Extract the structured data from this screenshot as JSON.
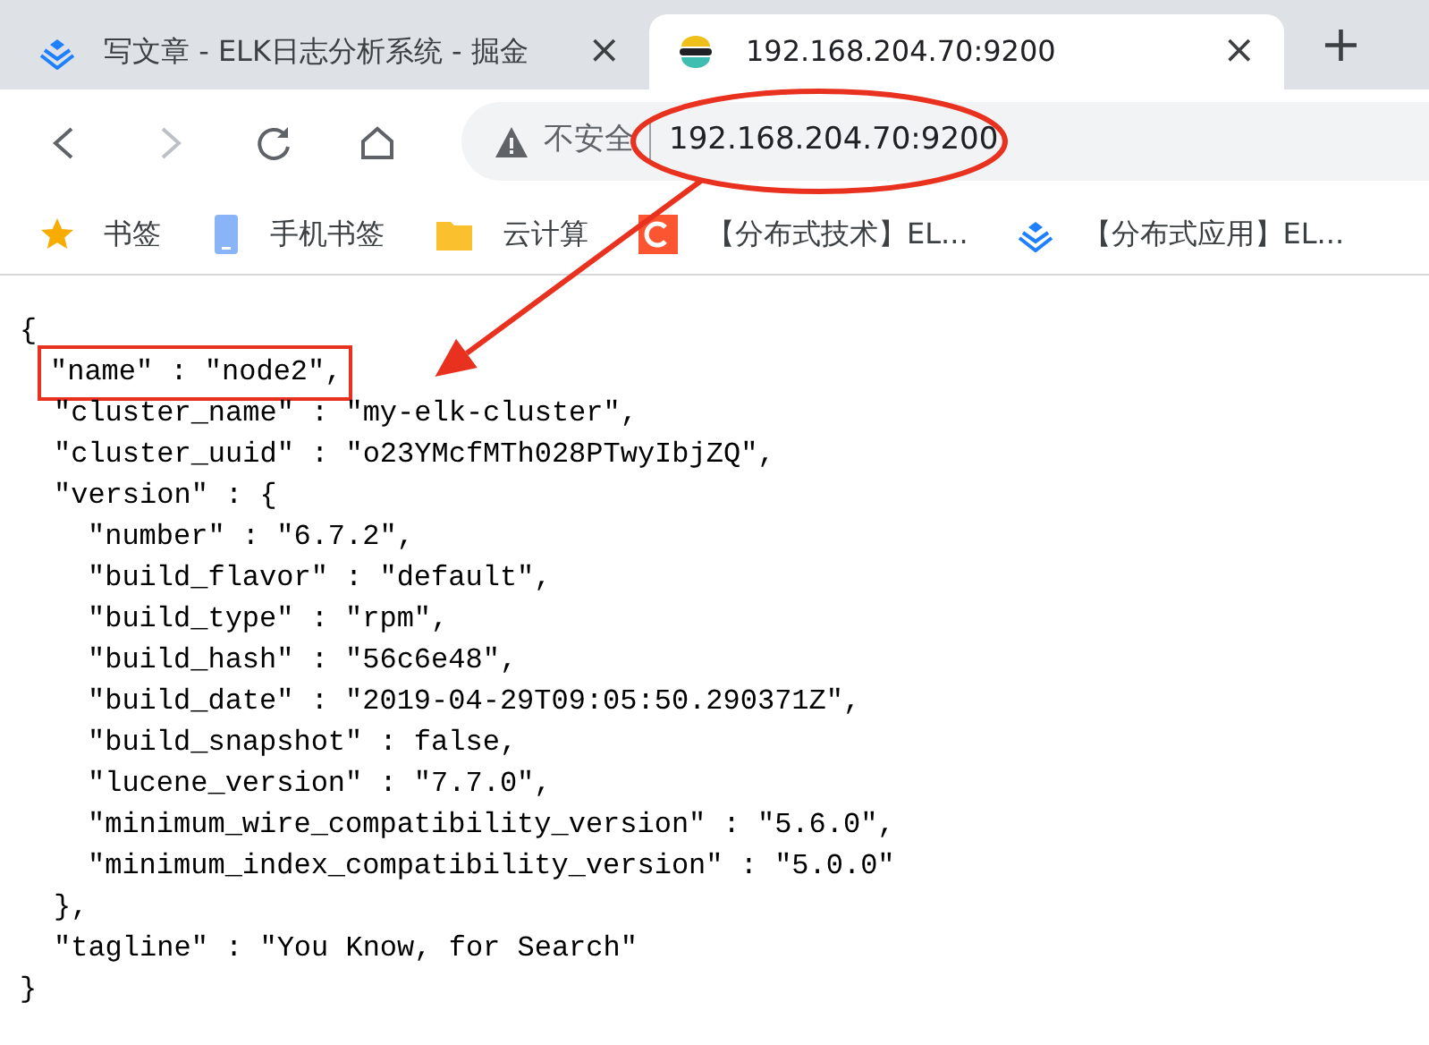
{
  "tabs": [
    {
      "title": "写文章 - ELK日志分析系统 - 掘金",
      "selected": false,
      "close": "×"
    },
    {
      "title": "192.168.204.70:9200",
      "selected": true,
      "close": "×"
    }
  ],
  "new_tab": "+",
  "address_bar": {
    "security": "不安全",
    "url": "192.168.204.70:9200",
    "circled": true
  },
  "bookmarks": [
    {
      "label": "书签"
    },
    {
      "label": "手机书签"
    },
    {
      "label": "云计算"
    },
    {
      "label": "【分布式技术】EL..."
    },
    {
      "label": "【分布式应用】EL..."
    }
  ],
  "json_body": [
    {
      "text": "{",
      "children": [
        {
          "text": "\"name\" : \"node2\",",
          "highlighted": true
        },
        {
          "text": "\"cluster_name\" : \"my-elk-cluster\",",
          "highlighted": false
        },
        {
          "text": "\"cluster_uuid\" : \"o23YMcfMTh028PTwyIbjZQ\",",
          "highlighted": false
        },
        {
          "text": "\"version\" : {",
          "highlighted": false,
          "children": [
            {
              "text": "\"number\" : \"6.7.2\","
            },
            {
              "text": "\"build_flavor\" : \"default\","
            },
            {
              "text": "\"build_type\" : \"rpm\","
            },
            {
              "text": "\"build_hash\" : \"56c6e48\","
            },
            {
              "text": "\"build_date\" : \"2019-04-29T09:05:50.290371Z\","
            },
            {
              "text": "\"build_snapshot\" : false,"
            },
            {
              "text": "\"lucene_version\" : \"7.7.0\","
            },
            {
              "text": "\"minimum_wire_compatibility_version\" : \"5.6.0\","
            },
            {
              "text": "\"minimum_index_compatibility_version\" : \"5.0.0\""
            }
          ]
        },
        {
          "text": "},",
          "highlighted": false
        },
        {
          "text": "\"tagline\" : \"You Know, for Search\"",
          "highlighted": false
        }
      ]
    },
    {
      "text": "}"
    }
  ]
}
